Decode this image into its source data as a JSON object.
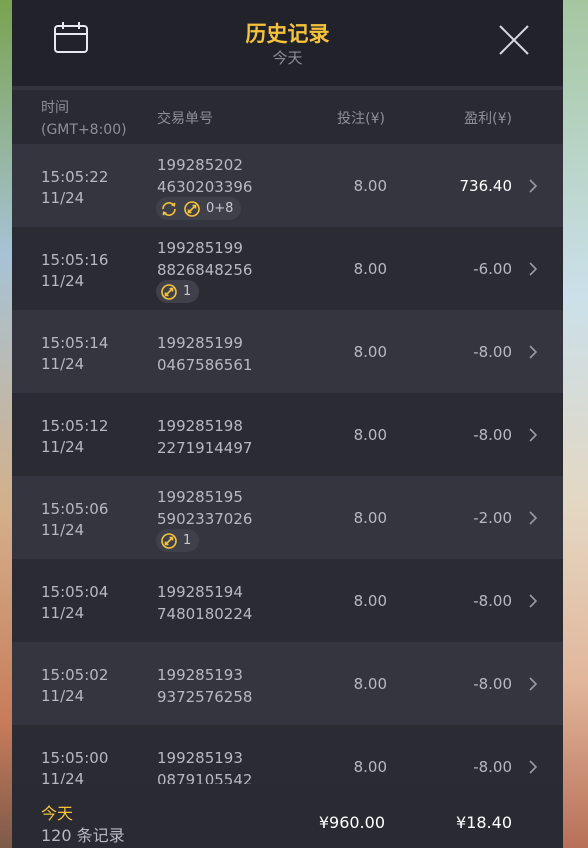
{
  "header": {
    "title": "历史记录",
    "subtitle": "今天",
    "calendar_icon": "calendar-icon",
    "close_icon": "close-icon"
  },
  "columns": {
    "time_line1": "时间",
    "time_line2": "(GMT+8:00)",
    "order": "交易单号",
    "bet": "投注(¥)",
    "profit": "盈利(¥)"
  },
  "rows": [
    {
      "time": "15:05:22",
      "date": "11/24",
      "order1": "199285202",
      "order2": "4630203396",
      "bet": "8.00",
      "profit": "736.40",
      "tags": {
        "icons": [
          "refresh-icon",
          "ball-icon"
        ],
        "text": "0+8"
      }
    },
    {
      "time": "15:05:16",
      "date": "11/24",
      "order1": "199285199",
      "order2": "8826848256",
      "bet": "8.00",
      "profit": "-6.00",
      "tags": {
        "icons": [
          "ball-icon"
        ],
        "text": "1"
      }
    },
    {
      "time": "15:05:14",
      "date": "11/24",
      "order1": "199285199",
      "order2": "0467586561",
      "bet": "8.00",
      "profit": "-8.00"
    },
    {
      "time": "15:05:12",
      "date": "11/24",
      "order1": "199285198",
      "order2": "2271914497",
      "bet": "8.00",
      "profit": "-8.00"
    },
    {
      "time": "15:05:06",
      "date": "11/24",
      "order1": "199285195",
      "order2": "5902337026",
      "bet": "8.00",
      "profit": "-2.00",
      "tags": {
        "icons": [
          "ball-icon"
        ],
        "text": "1"
      }
    },
    {
      "time": "15:05:04",
      "date": "11/24",
      "order1": "199285194",
      "order2": "7480180224",
      "bet": "8.00",
      "profit": "-8.00"
    },
    {
      "time": "15:05:02",
      "date": "11/24",
      "order1": "199285193",
      "order2": "9372576258",
      "bet": "8.00",
      "profit": "-8.00"
    },
    {
      "time": "15:05:00",
      "date": "11/24",
      "order1": "199285193",
      "order2": "0879105542",
      "bet": "8.00",
      "profit": "-8.00"
    }
  ],
  "footer": {
    "today": "今天",
    "count": "120 条记录",
    "total_bet": "¥960.00",
    "total_profit": "¥18.40"
  },
  "colors": {
    "accent": "#f5c33b",
    "panel_bg": "#22222b",
    "row_light": "#35353f",
    "row_dark": "#2b2b34"
  }
}
